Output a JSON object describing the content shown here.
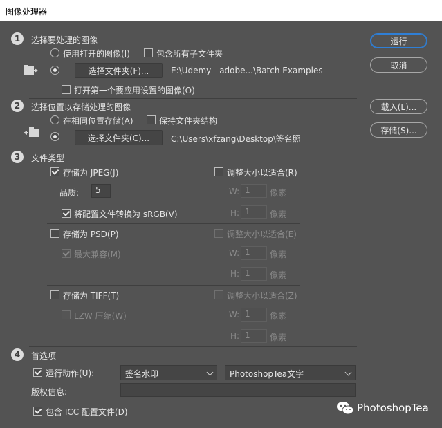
{
  "window": {
    "title": "图像处理器"
  },
  "section1": {
    "num": "1",
    "title": "选择要处理的图像",
    "use_open_images": "使用打开的图像(I)",
    "include_subfolders": "包含所有子文件夹",
    "choose_folder_button": "选择文件夹(F)...",
    "folder_path": "E:\\Udemy - adobe...\\Batch Examples",
    "open_first_image": "打开第一个要应用设置的图像(O)"
  },
  "section2": {
    "num": "2",
    "title": "选择位置以存储处理的图像",
    "same_location": "在相同位置存储(A)",
    "keep_structure": "保持文件夹结构",
    "choose_folder_button": "选择文件夹(C)...",
    "folder_path": "C:\\Users\\xfzang\\Desktop\\签名照"
  },
  "section3": {
    "num": "3",
    "title": "文件类型",
    "jpeg": {
      "save_as": "存储为 JPEG(J)",
      "quality_label": "品质:",
      "quality_value": "5",
      "convert_srgb": "将配置文件转换为 sRGB(V)",
      "resize": "调整大小以适合(R)",
      "w_label": "W:",
      "h_label": "H:",
      "w_value": "1",
      "h_value": "1",
      "unit": "像素"
    },
    "psd": {
      "save_as": "存储为 PSD(P)",
      "max_compat": "最大兼容(M)",
      "resize": "调整大小以适合(E)",
      "w_label": "W:",
      "h_label": "H:",
      "w_value": "1",
      "h_value": "1",
      "unit": "像素"
    },
    "tiff": {
      "save_as": "存储为 TIFF(T)",
      "lzw": "LZW 压缩(W)",
      "resize": "调整大小以适合(Z)",
      "w_label": "W:",
      "h_label": "H:",
      "w_value": "1",
      "h_value": "1",
      "unit": "像素"
    }
  },
  "section4": {
    "num": "4",
    "title": "首选项",
    "run_action": "运行动作(U):",
    "action_value": "签名水印",
    "action_set_value": "PhotoshopTea文字",
    "copyright_label": "版权信息:",
    "copyright_value": "",
    "include_icc": "包含 ICC 配置文件(D)"
  },
  "buttons": {
    "run": "运行",
    "cancel": "取消",
    "load": "载入(L)...",
    "save": "存储(S)..."
  },
  "watermark": {
    "text": "PhotoshopTea"
  }
}
